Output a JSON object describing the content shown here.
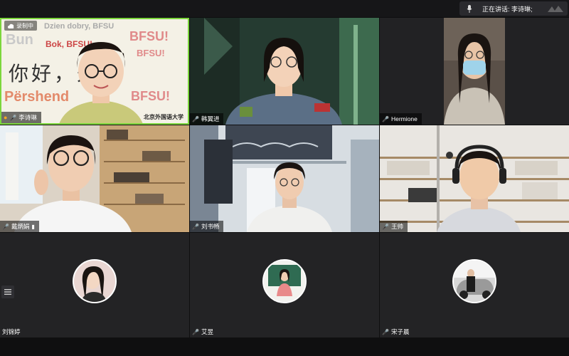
{
  "top_bar": {
    "speaking_label": "正在讲话: 李诗琳;"
  },
  "tiles": [
    {
      "name": "李诗琳",
      "recording_label": "录制中"
    },
    {
      "name": "韩翼进"
    },
    {
      "name": "Hermione"
    },
    {
      "name": "戴炳娟"
    },
    {
      "name": "刘书畅"
    },
    {
      "name": "王帅"
    },
    {
      "name": "刘锦婷"
    },
    {
      "name": "艾昱"
    },
    {
      "name": "宋子晨"
    }
  ],
  "background_words": {
    "greeting_cn": "你好，外！",
    "bfsu": "BFSU!",
    "pershendetje": "Përshend",
    "dzien_dobry": "Dzien dobry, BFSU",
    "bun": "Bun",
    "bok": "Bok, BFSU!",
    "logo_text": "北京外国语大学"
  },
  "colors": {
    "active_border": "#7cd63c",
    "tile_bg": "#232325",
    "page_bg": "#0f0f10"
  }
}
